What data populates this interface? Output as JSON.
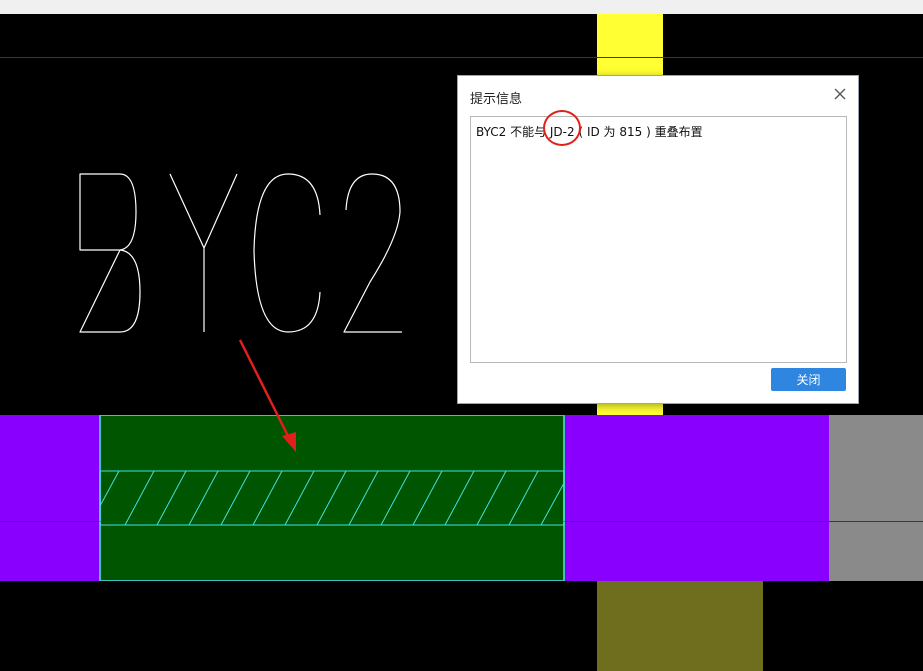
{
  "drawing": {
    "label": "BYC2",
    "label_color": "#ffffff",
    "line_color": "#c00000",
    "wall_color": "#005500",
    "column_color": "#8a00ff",
    "hatch_color": "#40e0e0",
    "annotation_color": "#e0201a"
  },
  "dialog": {
    "title": "提示信息",
    "message": "BYC2 不能与 JD-2 ( ID 为 815 ) 重叠布置",
    "button_label": "关闭"
  }
}
